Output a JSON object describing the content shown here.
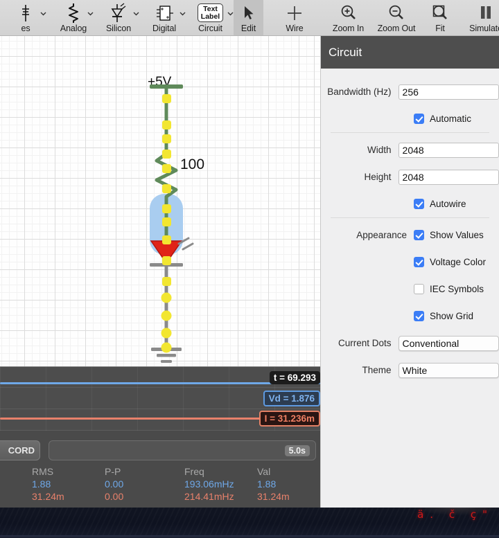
{
  "toolbar": {
    "items": [
      {
        "label": "es",
        "icon": "sources-icon",
        "chevron": true
      },
      {
        "label": "Analog",
        "icon": "resistor-icon",
        "chevron": true
      },
      {
        "label": "Silicon",
        "icon": "diode-icon",
        "chevron": true
      },
      {
        "label": "Digital",
        "icon": "ic-chip-icon",
        "chevron": true
      },
      {
        "label": "Circuit",
        "icon": "text-label-icon",
        "chevron": true
      },
      {
        "label": "Edit",
        "icon": "cursor-arrow-icon",
        "chevron": false,
        "selected": true
      },
      {
        "label": "Wire",
        "icon": "plus-icon",
        "chevron": false
      },
      {
        "label": "Zoom In",
        "icon": "magnifier-plus-icon",
        "chevron": false
      },
      {
        "label": "Zoom Out",
        "icon": "magnifier-minus-icon",
        "chevron": false
      },
      {
        "label": "Fit",
        "icon": "magnifier-fit-icon",
        "chevron": false
      },
      {
        "label": "Simulate",
        "icon": "pause-icon",
        "chevron": false
      }
    ],
    "text_label_line1": "Text",
    "text_label_line2": "Label"
  },
  "canvas": {
    "supply_label": "+5V",
    "resistor_value": "100",
    "components": [
      "voltage-source",
      "resistor",
      "led",
      "ground"
    ],
    "wire_color_top": "#5f8a5a",
    "wire_color_bottom": "#8a8a8a",
    "current_dot_color": "#f2e631",
    "selection_color": "#a9cdf0",
    "led_color": "#e02318"
  },
  "inspector": {
    "title": "Circuit",
    "bandwidth_label": "Bandwidth (Hz)",
    "bandwidth_value": "256",
    "automatic_label": "Automatic",
    "automatic_checked": true,
    "width_label": "Width",
    "width_value": "2048",
    "height_label": "Height",
    "height_value": "2048",
    "autowire_label": "Autowire",
    "autowire_checked": true,
    "appearance_label": "Appearance",
    "show_values_label": "Show Values",
    "show_values_checked": true,
    "voltage_color_label": "Voltage Color",
    "voltage_color_checked": true,
    "iec_symbols_label": "IEC Symbols",
    "iec_symbols_checked": false,
    "show_grid_label": "Show Grid",
    "show_grid_checked": true,
    "current_dots_label": "Current Dots",
    "current_dots_value": "Conventional",
    "theme_label": "Theme",
    "theme_value": "White",
    "accent_color": "#3b7df6"
  },
  "scope": {
    "time_badge": "t = 69.293",
    "voltage_badge": "Vd = 1.876",
    "current_badge": "I = 31.236m",
    "record_button": "CORD",
    "time_scale": "5.0s",
    "voltage_trace_color": "#6fa8e8",
    "current_trace_color": "#e8816b"
  },
  "measurements": {
    "headers": [
      "RMS",
      "P-P",
      "Freq",
      "Val"
    ],
    "rows": [
      {
        "color": "voltage",
        "rms": "1.88",
        "pp": "0.00",
        "freq": "193.06mHz",
        "val": "1.88"
      },
      {
        "color": "current",
        "rms": "31.24m",
        "pp": "0.00",
        "freq": "214.41mHz",
        "val": "31.24m"
      }
    ]
  },
  "desktop": {
    "glyphs": "ä. č  ç\""
  }
}
